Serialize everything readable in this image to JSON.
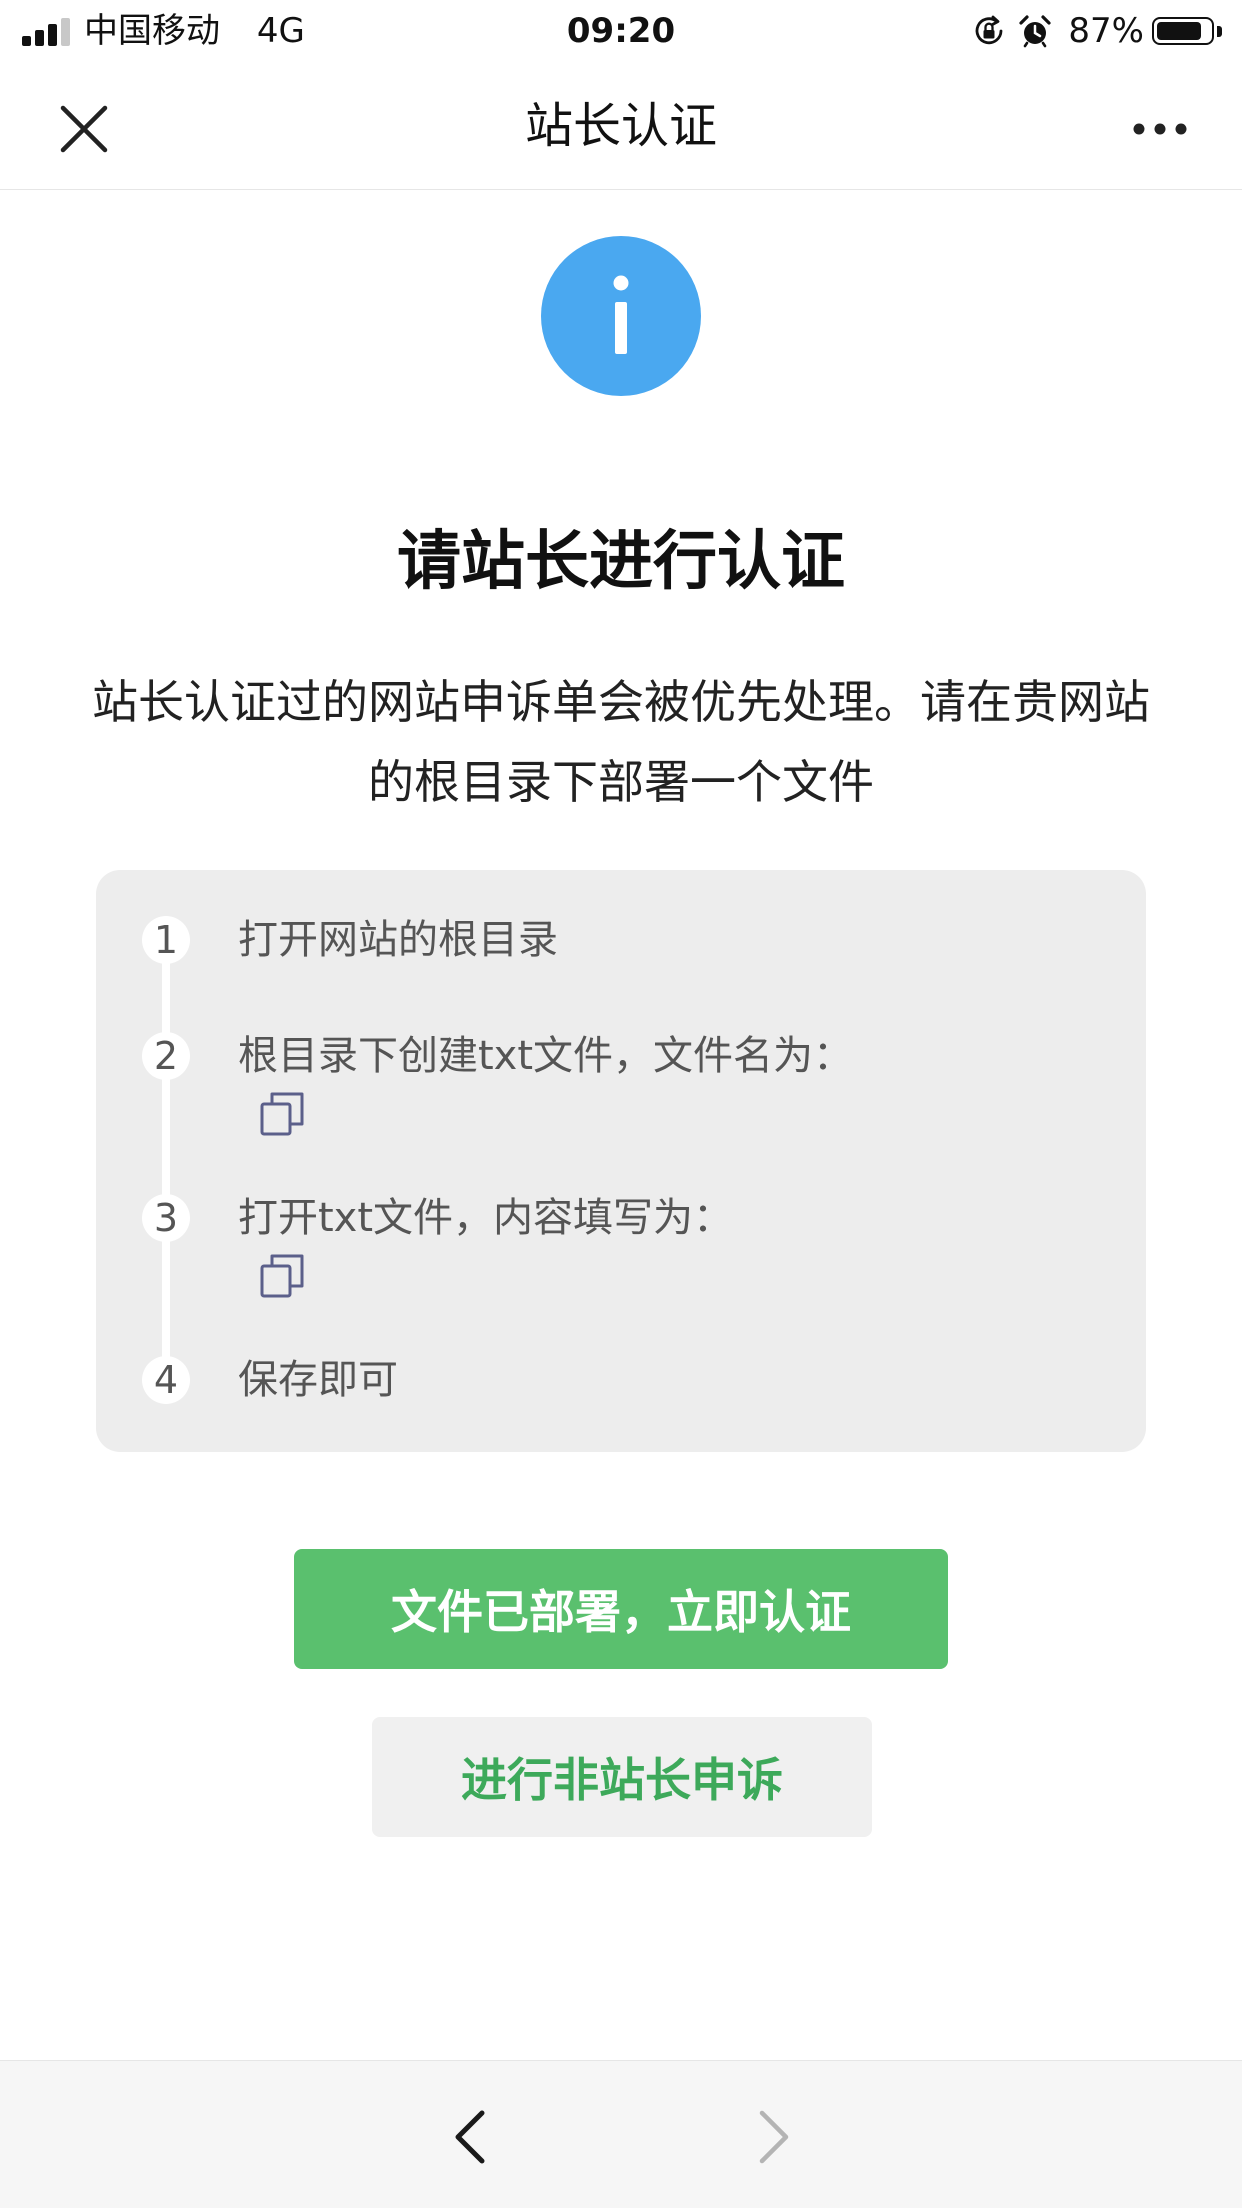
{
  "status_bar": {
    "carrier": "中国移动",
    "network": "4G",
    "time": "09:20",
    "battery_percent": "87%",
    "battery_level": 0.87,
    "icons": [
      "signal-icon",
      "rotation-lock-icon",
      "alarm-icon",
      "battery-icon"
    ]
  },
  "nav": {
    "title": "站长认证",
    "close_icon": "close-icon",
    "more_icon": "more-icon"
  },
  "main": {
    "icon": "info-icon",
    "heading": "请站长进行认证",
    "description": "站长认证过的网站申诉单会被优先处理。请在贵网站的根目录下部署一个文件",
    "steps": [
      {
        "number": "1",
        "text": "打开网站的根目录"
      },
      {
        "number": "2",
        "text": "根目录下创建txt文件，文件名为："
      },
      {
        "number": "3",
        "text": "打开txt文件，内容填写为："
      },
      {
        "number": "4",
        "text": "保存即可"
      }
    ],
    "primary_button": "文件已部署，立即认证",
    "secondary_button": "进行非站长申诉"
  },
  "toolbar": {
    "back_icon": "chevron-left-icon",
    "forward_icon": "chevron-right-icon"
  },
  "colors": {
    "accent_blue": "#4aa8f0",
    "primary_green": "#5ac06e",
    "link_green": "#3da95a",
    "card_gray": "#ededed"
  }
}
